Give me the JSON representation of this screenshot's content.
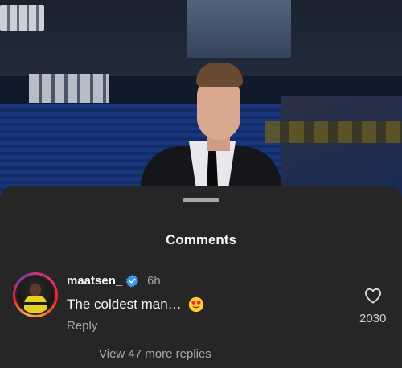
{
  "sheet": {
    "title": "Comments"
  },
  "comment": {
    "username": "maatsen_",
    "verified": true,
    "timestamp": "6h",
    "text": "The coldest man…",
    "emoji": "heart-eyes",
    "reply_label": "Reply",
    "like_count": "2030",
    "view_replies_label": "View 47 more replies"
  },
  "colors": {
    "sheet_bg": "#262626",
    "verified_blue": "#3897f0",
    "muted_text": "#a8a8a8"
  }
}
